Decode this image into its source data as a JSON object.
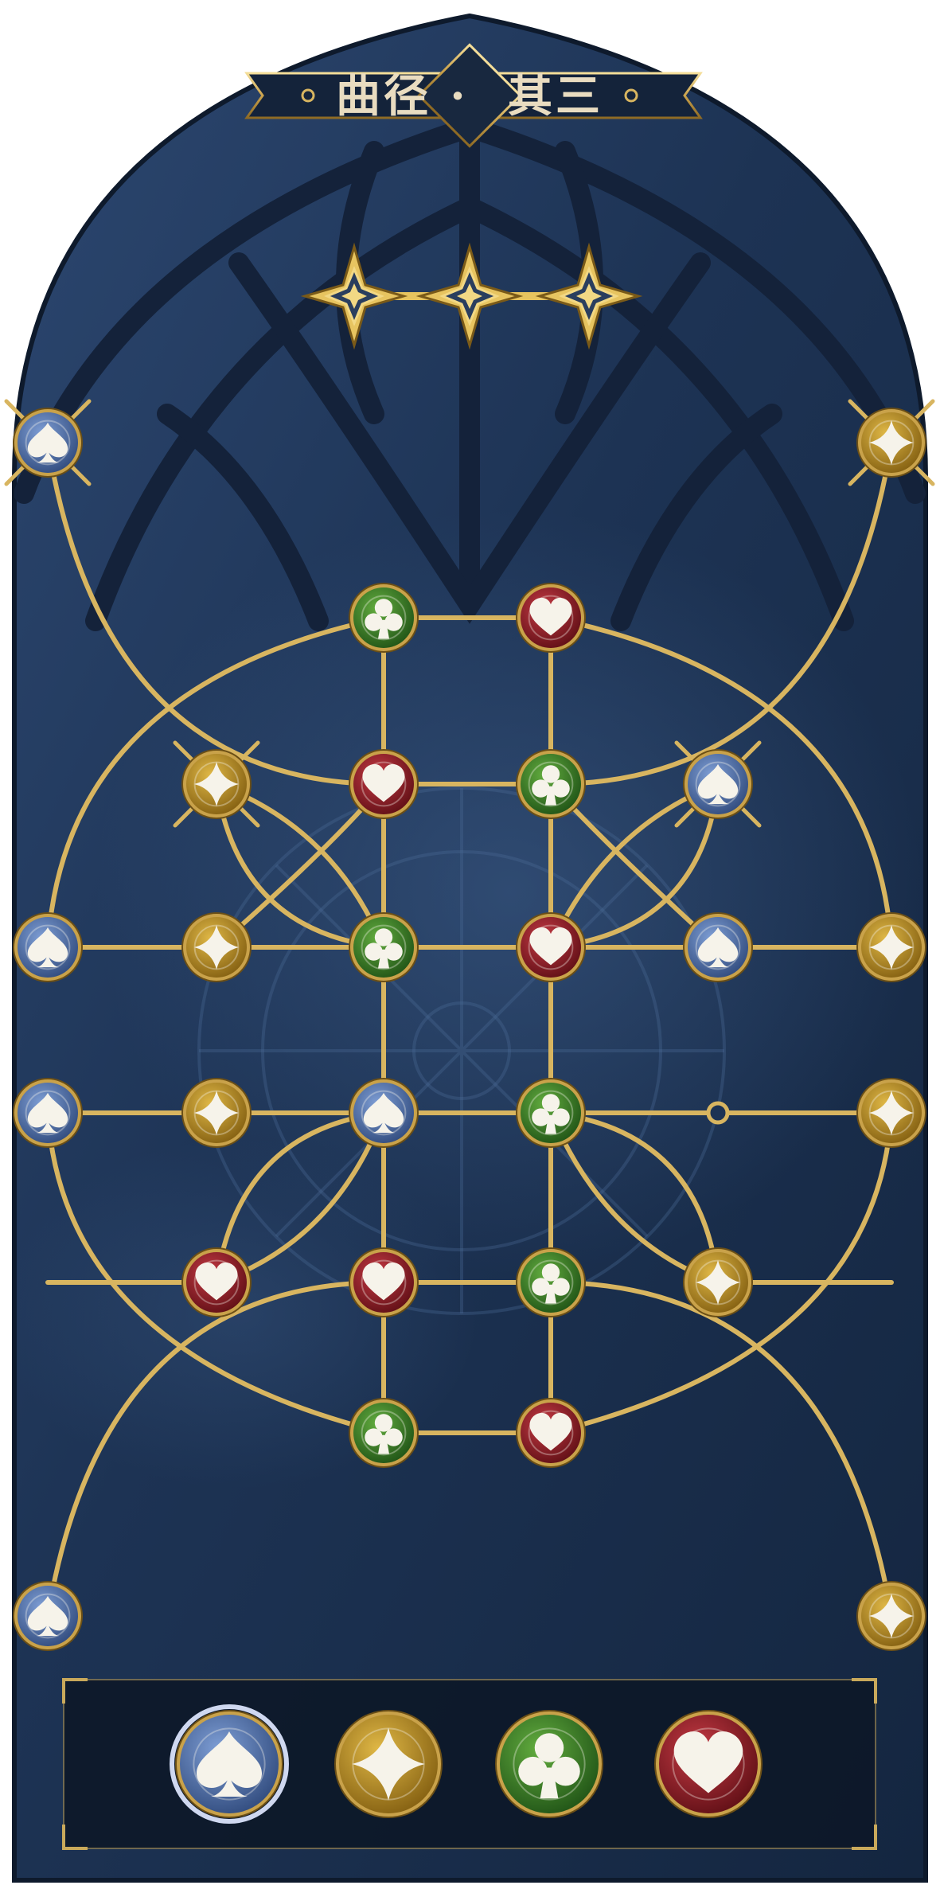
{
  "puzzle": {
    "title_left": "曲径",
    "title_right": "其三",
    "separator": "·",
    "progress": {
      "stars_total": 3,
      "stars_lit": 3
    }
  },
  "colors": {
    "gold": "#d8b560",
    "frame_bg": "#1c3150",
    "spade": "#4d6ea8",
    "diamond": "#b8891c",
    "club": "#2f7a22",
    "heart": "#8e1c24",
    "glyph_light": "#f6f3ea"
  },
  "icon_names": {
    "spade": "spade-icon",
    "diamond": "diamond-icon",
    "club": "club-icon",
    "heart": "heart-icon"
  },
  "nodes": [
    {
      "id": "n1",
      "suit": "spade",
      "crossed": true
    },
    {
      "id": "n2",
      "suit": "diamond",
      "crossed": true
    },
    {
      "id": "n3",
      "suit": "club"
    },
    {
      "id": "n4",
      "suit": "heart"
    },
    {
      "id": "n5",
      "suit": "diamond",
      "crossed": true
    },
    {
      "id": "n6",
      "suit": "heart"
    },
    {
      "id": "n7",
      "suit": "club"
    },
    {
      "id": "n8",
      "suit": "spade",
      "crossed": true
    },
    {
      "id": "n9",
      "suit": "spade"
    },
    {
      "id": "n10",
      "suit": "diamond"
    },
    {
      "id": "n11",
      "suit": "club"
    },
    {
      "id": "n12",
      "suit": "heart"
    },
    {
      "id": "n13",
      "suit": "spade"
    },
    {
      "id": "n14",
      "suit": "diamond"
    },
    {
      "id": "n15",
      "suit": "spade"
    },
    {
      "id": "n16",
      "suit": "diamond"
    },
    {
      "id": "n17",
      "suit": "spade"
    },
    {
      "id": "n18",
      "suit": "club"
    },
    {
      "id": "n19",
      "suit": "diamond"
    },
    {
      "id": "n20",
      "suit": "heart"
    },
    {
      "id": "n21",
      "suit": "heart"
    },
    {
      "id": "n22",
      "suit": "club"
    },
    {
      "id": "n23",
      "suit": "diamond"
    },
    {
      "id": "n24",
      "suit": "club"
    },
    {
      "id": "n25",
      "suit": "heart"
    },
    {
      "id": "n26",
      "suit": "spade"
    },
    {
      "id": "n27",
      "suit": "diamond"
    }
  ],
  "palette": [
    {
      "suit": "spade",
      "selected": true
    },
    {
      "suit": "diamond"
    },
    {
      "suit": "club"
    },
    {
      "suit": "heart"
    }
  ]
}
